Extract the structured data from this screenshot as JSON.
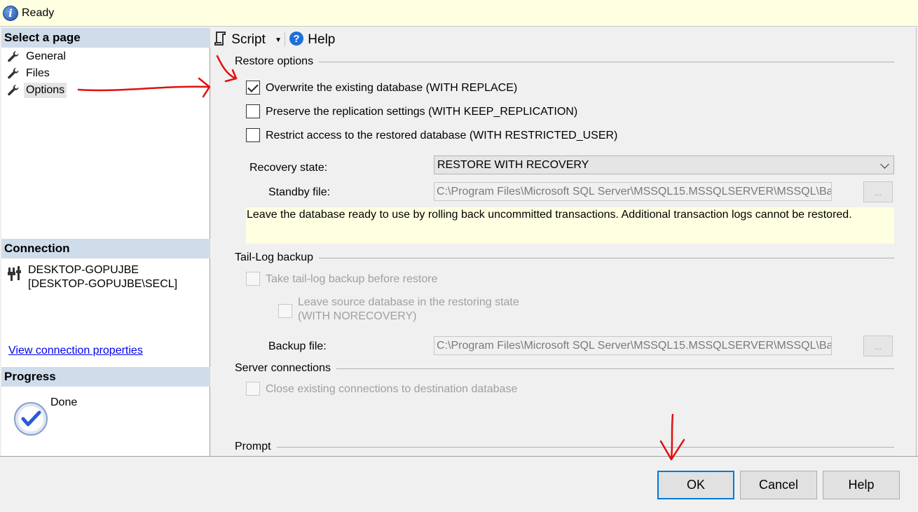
{
  "status": {
    "text": "Ready"
  },
  "left": {
    "select_page_header": "Select a page",
    "pages": [
      {
        "label": "General"
      },
      {
        "label": "Files"
      },
      {
        "label": "Options",
        "selected": true
      }
    ],
    "connection_header": "Connection",
    "connection_server": "DESKTOP-GOPUJBE",
    "connection_user": "[DESKTOP-GOPUJBE\\SECL]",
    "view_connection_link": "View connection properties",
    "progress_header": "Progress",
    "progress_status": "Done"
  },
  "toolbar": {
    "script_label": "Script",
    "help_label": "Help"
  },
  "restore_options": {
    "title": "Restore options",
    "overwrite": {
      "label": "Overwrite the existing database (WITH REPLACE)",
      "checked": true
    },
    "preserve": {
      "label": "Preserve the replication settings (WITH KEEP_REPLICATION)",
      "checked": false
    },
    "restrict": {
      "label": "Restrict access to the restored database (WITH RESTRICTED_USER)",
      "checked": false
    },
    "recovery_state_label": "Recovery state:",
    "recovery_state_value": "RESTORE WITH RECOVERY",
    "standby_file_label": "Standby file:",
    "standby_file_value": "C:\\Program Files\\Microsoft SQL Server\\MSSQL15.MSSQLSERVER\\MSSQL\\Ba",
    "browse_label": "...",
    "description": "Leave the database ready to use by rolling back uncommitted transactions. Additional transaction logs cannot be restored."
  },
  "tail_log": {
    "title": "Tail-Log backup",
    "take_backup": {
      "label": "Take tail-log backup before restore",
      "checked": false,
      "enabled": false
    },
    "leave_source_line1": "Leave source database in the restoring state",
    "leave_source_line2": "(WITH NORECOVERY)",
    "backup_file_label": "Backup file:",
    "backup_file_value": "C:\\Program Files\\Microsoft SQL Server\\MSSQL15.MSSQLSERVER\\MSSQL\\Ba",
    "browse_label": "..."
  },
  "server_connections": {
    "title": "Server connections",
    "close_existing": {
      "label": "Close existing connections to destination database",
      "checked": false,
      "enabled": false
    }
  },
  "prompt": {
    "title": "Prompt"
  },
  "buttons": {
    "ok": "OK",
    "cancel": "Cancel",
    "help": "Help"
  },
  "colors": {
    "accent": "#0078d7",
    "annotation": "#e01010",
    "info_bg": "#ffffe1",
    "header_bg": "#cfdcea"
  }
}
